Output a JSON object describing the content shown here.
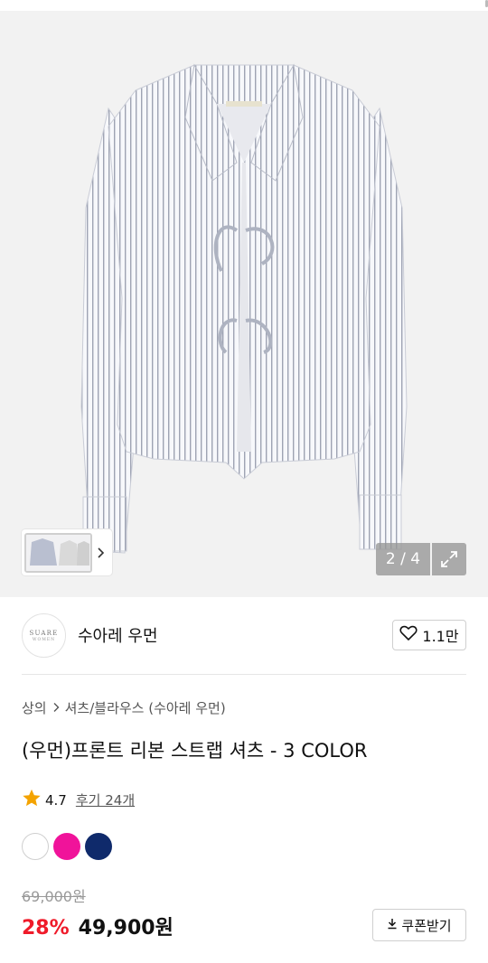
{
  "gallery": {
    "counter": "2 / 4",
    "current_index": 2,
    "total": 4
  },
  "brand": {
    "logo_line1": "SUARE",
    "logo_line2": "WOMEN",
    "name": "수아레 우먼",
    "likes": "1.1만"
  },
  "breadcrumb": {
    "category": "상의",
    "subcategory": "셔츠/블라우스 (수아레 우먼)"
  },
  "product": {
    "title": "(우먼)프론트 리본 스트랩 셔츠 - 3 COLOR",
    "rating": "4.7",
    "reviews": "후기 24개",
    "colors": [
      "#ffffff",
      "#f0139a",
      "#0f2a6b"
    ],
    "original_price": "69,000원",
    "discount": "28%",
    "sale_price": "49,900원",
    "coupon_label": "쿠폰받기"
  },
  "icons": {
    "like": "heart-icon",
    "star": "star-icon",
    "download": "download-icon",
    "expand": "expand-icon",
    "chevron": "chevron-right-icon"
  },
  "colors": {
    "accent_red": "#ef1b2a",
    "star": "#f4a300"
  }
}
